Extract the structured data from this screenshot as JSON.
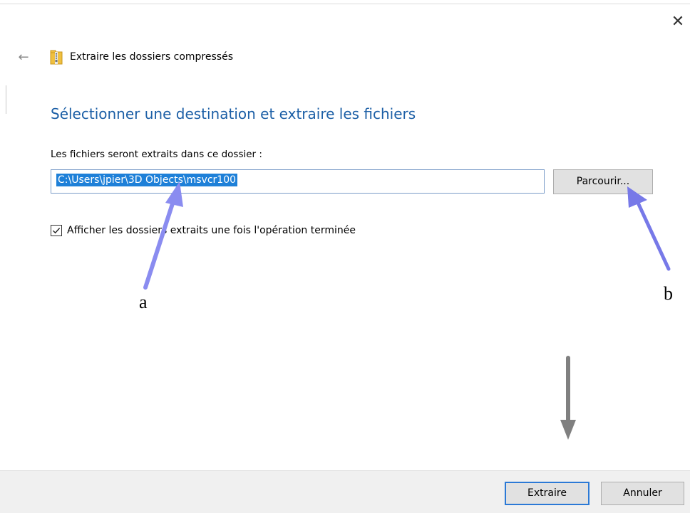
{
  "window": {
    "title": "Extraire les dossiers compressés",
    "close_icon": "close-icon",
    "back_icon": "back-arrow-icon",
    "app_icon": "zip-folder-icon"
  },
  "main": {
    "instruction": "Sélectionner une destination et extraire les fichiers",
    "path_label": "Les fichiers seront extraits dans ce dossier :",
    "path_value": "C:\\Users\\jpier\\3D Objects\\msvcr100",
    "browse_label": "Parcourir...",
    "show_folders_checked": true,
    "show_folders_label": "Afficher les dossiers extraits une fois l'opération terminée"
  },
  "footer": {
    "extract_label": "Extraire",
    "cancel_label": "Annuler"
  },
  "annotations": {
    "a": "a",
    "b": "b",
    "arrow_color": "#8a8cf0",
    "gray_arrow_color": "#808080"
  },
  "colors": {
    "accent": "#1c5fa6",
    "selection": "#1e80d8",
    "footer_bg": "#f0f0f0",
    "button_bg": "#e1e1e1"
  }
}
